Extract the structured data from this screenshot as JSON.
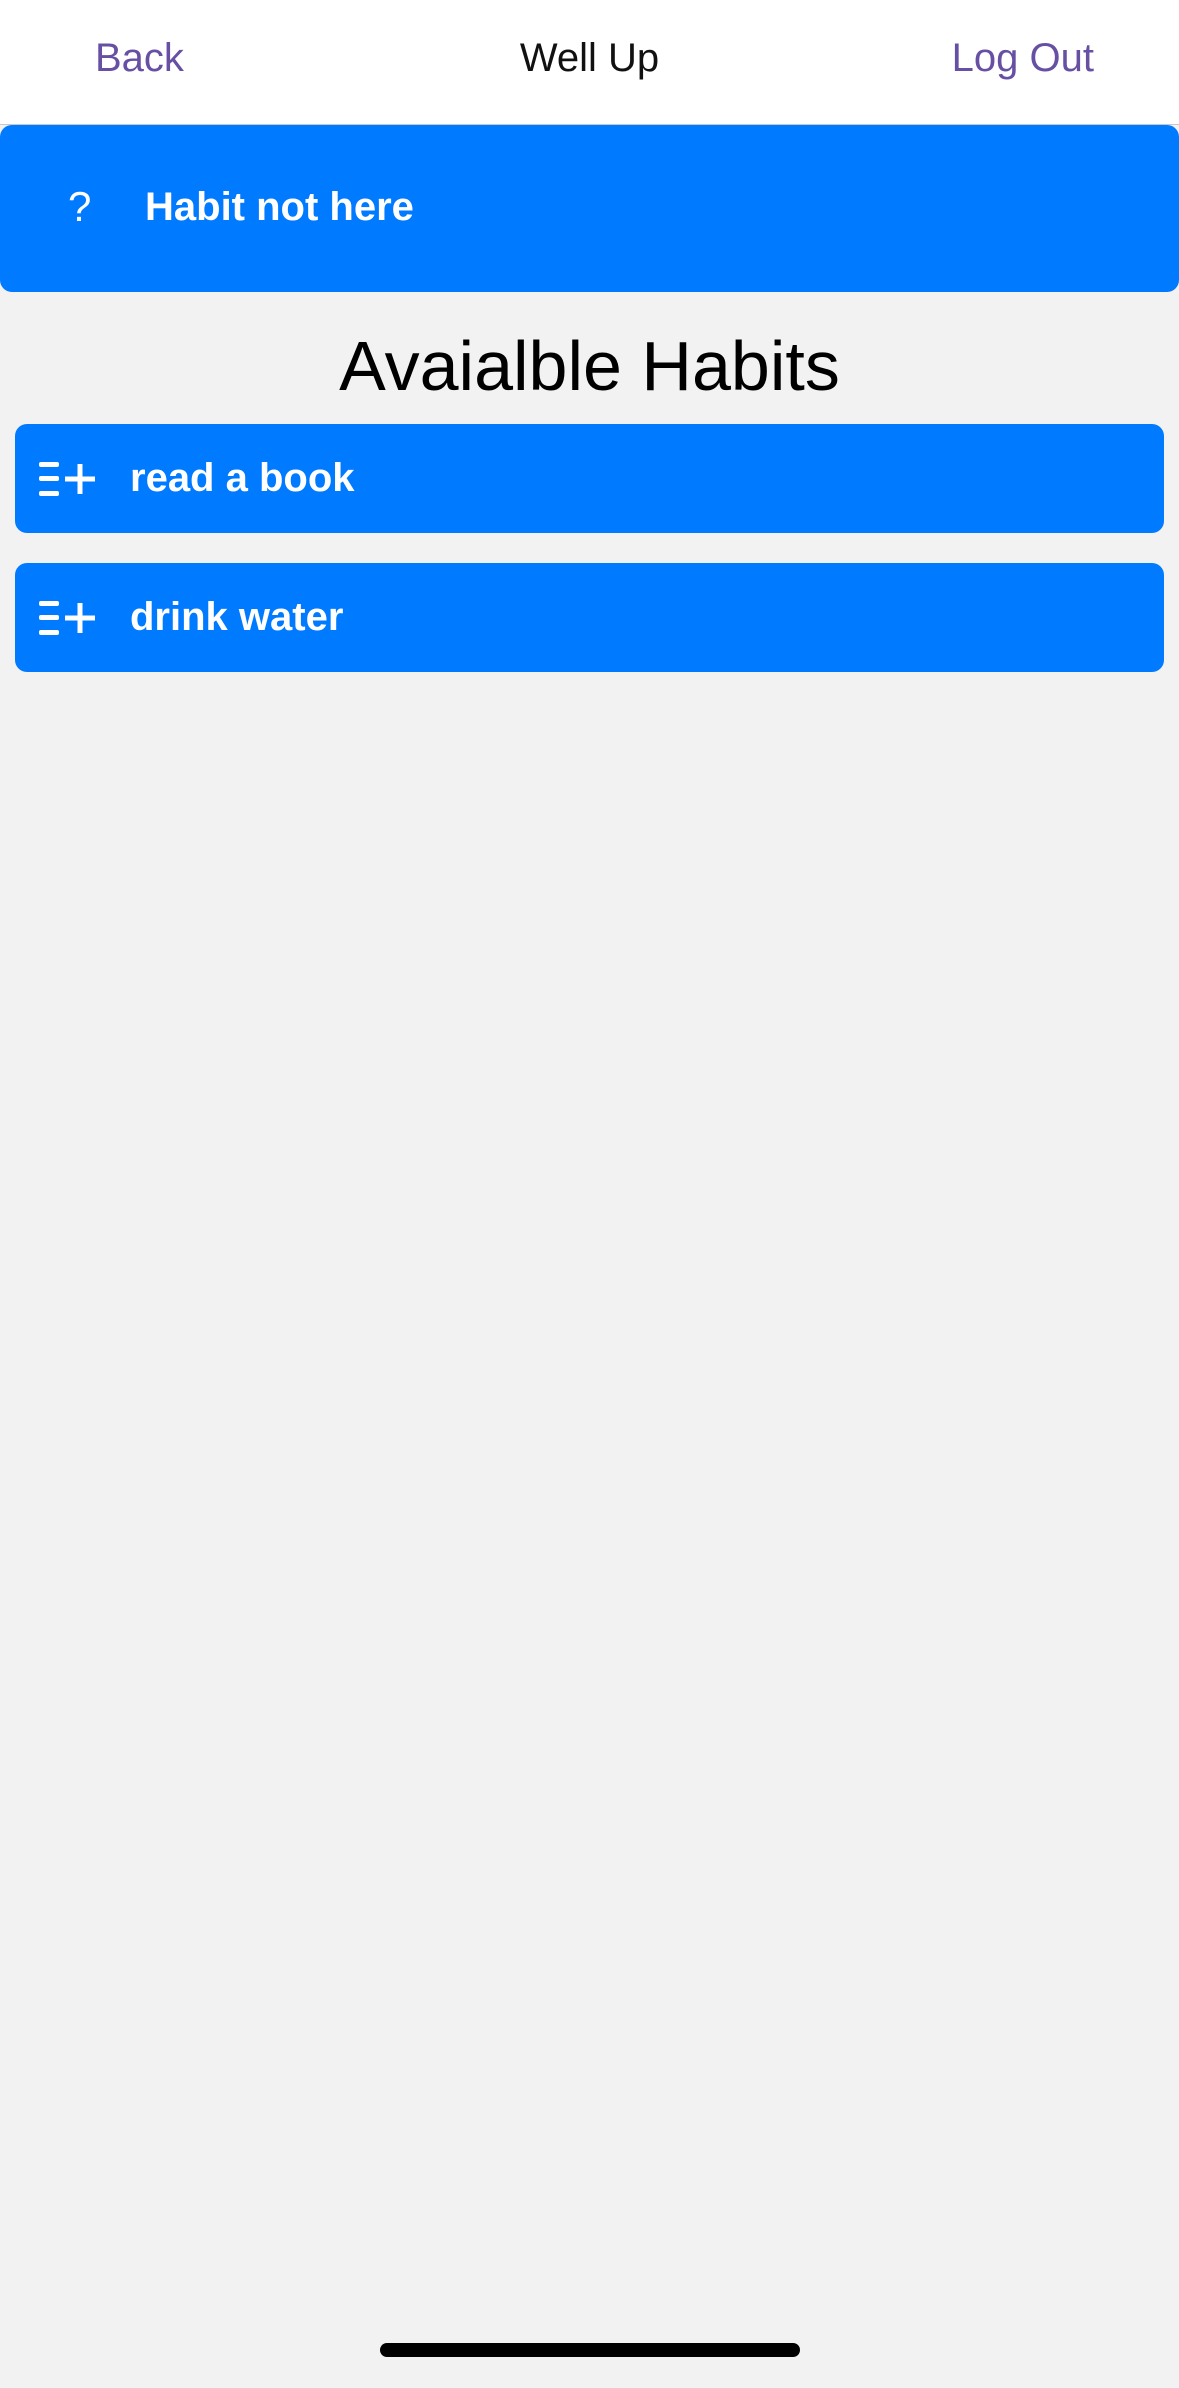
{
  "header": {
    "back_label": "Back",
    "title": "Well Up",
    "logout_label": "Log Out"
  },
  "banner": {
    "icon": "question-mark-icon",
    "icon_glyph": "?",
    "label": "Habit not here"
  },
  "main": {
    "heading": "Avaialble Habits",
    "habits": [
      {
        "label": "read a book",
        "icon": "list-add-icon"
      },
      {
        "label": "drink water",
        "icon": "list-add-icon"
      }
    ]
  },
  "colors": {
    "accent": "#007aff",
    "nav_link": "#6750a4",
    "background": "#f2f2f2"
  }
}
